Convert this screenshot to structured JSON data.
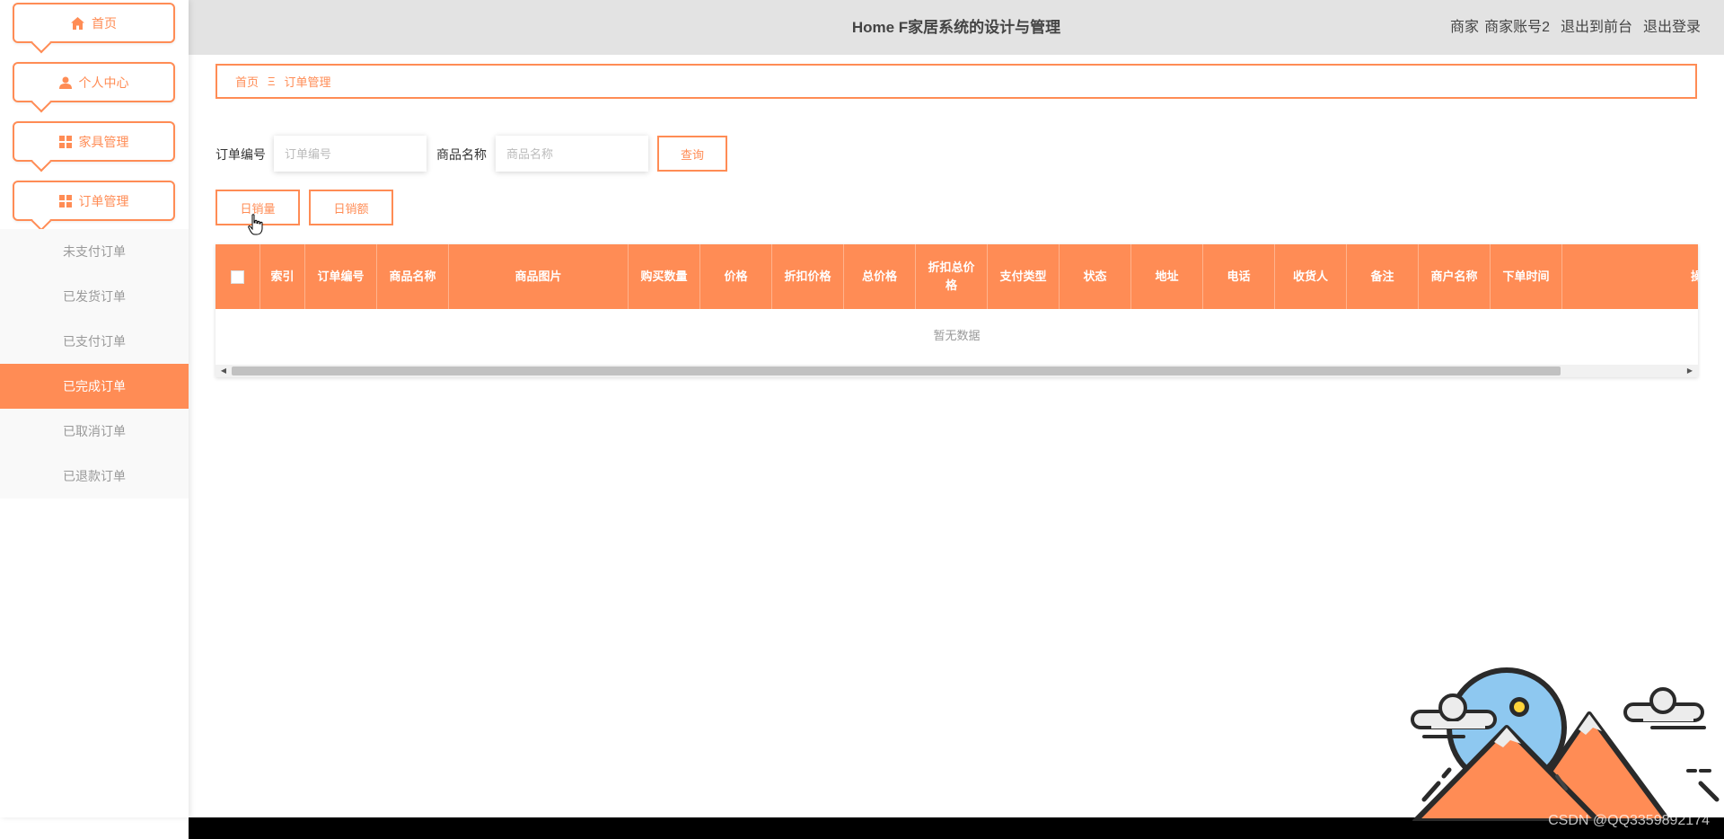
{
  "header": {
    "title": "Home F家居系统的设计与管理",
    "role": "商家",
    "account": "商家账号2",
    "exit_front": "退出到前台",
    "logout": "退出登录"
  },
  "sidebar": {
    "menu": [
      {
        "label": "首页",
        "icon": "home-icon"
      },
      {
        "label": "个人中心",
        "icon": "user-icon"
      },
      {
        "label": "家具管理",
        "icon": "grid-icon"
      },
      {
        "label": "订单管理",
        "icon": "grid-icon"
      }
    ],
    "submenu": [
      {
        "label": "未支付订单",
        "active": false
      },
      {
        "label": "已发货订单",
        "active": false
      },
      {
        "label": "已支付订单",
        "active": false
      },
      {
        "label": "已完成订单",
        "active": true
      },
      {
        "label": "已取消订单",
        "active": false
      },
      {
        "label": "已退款订单",
        "active": false
      }
    ]
  },
  "breadcrumb": {
    "home": "首页",
    "separator": "Ξ",
    "current": "订单管理"
  },
  "search": {
    "order_no_label": "订单编号",
    "order_no_placeholder": "订单编号",
    "order_no_value": "",
    "product_name_label": "商品名称",
    "product_name_placeholder": "商品名称",
    "product_name_value": "",
    "query_button": "查询"
  },
  "actions": {
    "daily_sales_qty": "日销量",
    "daily_sales_amount": "日销额"
  },
  "table": {
    "columns": [
      "索引",
      "订单编号",
      "商品名称",
      "商品图片",
      "购买数量",
      "价格",
      "折扣价格",
      "总价格",
      "折扣总价格",
      "支付类型",
      "状态",
      "地址",
      "电话",
      "收货人",
      "备注",
      "商户名称",
      "下单时间",
      "操"
    ],
    "rows": [],
    "empty_text": "暂无数据"
  },
  "watermark": "CSDN @QQ3359892174",
  "colors": {
    "accent": "#ff8c55",
    "header_bg": "#e3e3e3"
  }
}
